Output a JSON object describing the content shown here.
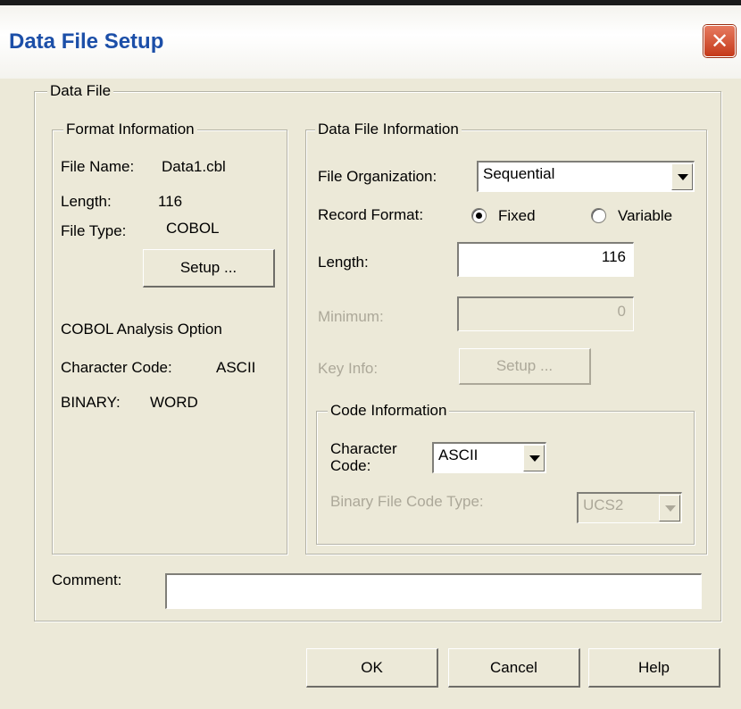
{
  "window": {
    "title": "Data File Setup",
    "close": "✕"
  },
  "data_file_group": {
    "legend": "Data File"
  },
  "format_info": {
    "legend": "Format Information",
    "file_name_label": "File Name:",
    "file_name_value": "Data1.cbl",
    "length_label": "Length:",
    "length_value": "116",
    "file_type_label": "File Type:",
    "file_type_value": "COBOL",
    "setup_button": "Setup ...",
    "analysis_option": "COBOL Analysis Option",
    "char_code_label": "Character Code:",
    "char_code_value": "ASCII",
    "binary_label": "BINARY:",
    "binary_value": "WORD"
  },
  "data_file_info": {
    "legend": "Data File Information",
    "organization_label": "File Organization:",
    "organization_value": "Sequential",
    "record_format_label": "Record Format:",
    "record_format_options": [
      "Fixed",
      "Variable"
    ],
    "record_format_selected": "Fixed",
    "length_label": "Length:",
    "length_value": "116",
    "minimum_label": "Minimum:",
    "minimum_value": "0",
    "key_info_label": "Key Info:",
    "key_info_button": "Setup ..."
  },
  "code_info": {
    "legend": "Code Information",
    "char_code_label_line1": "Character",
    "char_code_label_line2": "Code:",
    "char_code_value": "ASCII",
    "binary_code_label": "Binary File Code Type:",
    "binary_code_value": "UCS2"
  },
  "comment": {
    "label": "Comment:",
    "value": ""
  },
  "buttons": {
    "ok": "OK",
    "cancel": "Cancel",
    "help": "Help"
  }
}
